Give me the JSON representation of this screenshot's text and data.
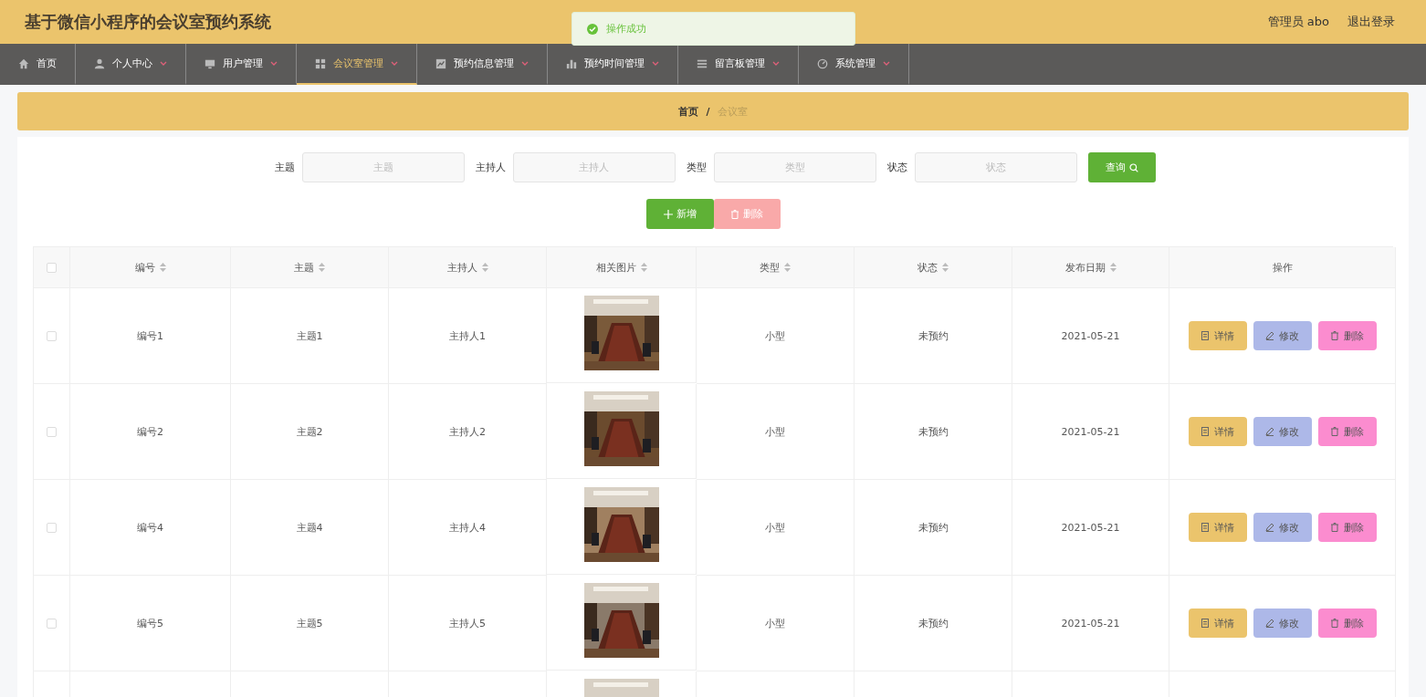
{
  "header": {
    "title": "基于微信小程序的会议室预约系统",
    "user": "管理员 abo",
    "logout": "退出登录"
  },
  "toast": {
    "message": "操作成功"
  },
  "nav": [
    {
      "label": "首页",
      "dropdown": false,
      "selected": false
    },
    {
      "label": "个人中心",
      "dropdown": true,
      "selected": false
    },
    {
      "label": "用户管理",
      "dropdown": true,
      "selected": false
    },
    {
      "label": "会议室管理",
      "dropdown": true,
      "selected": true
    },
    {
      "label": "预约信息管理",
      "dropdown": true,
      "selected": false
    },
    {
      "label": "预约时间管理",
      "dropdown": true,
      "selected": false
    },
    {
      "label": "留言板管理",
      "dropdown": true,
      "selected": false
    },
    {
      "label": "系统管理",
      "dropdown": true,
      "selected": false
    }
  ],
  "breadcrumb": {
    "items": [
      "首页",
      "会议室"
    ],
    "separator": "/"
  },
  "search": [
    {
      "label": "主题",
      "placeholder": "主题"
    },
    {
      "label": "主持人",
      "placeholder": "主持人"
    },
    {
      "label": "类型",
      "placeholder": "类型"
    },
    {
      "label": "状态",
      "placeholder": "状态"
    }
  ],
  "search_button": "查询",
  "add_button": "新增",
  "delete_button": {
    "label": "删除",
    "disabled": true
  },
  "table": {
    "select_all_checked": false,
    "columns": [
      "编号",
      "主题",
      "主持人",
      "相关图片",
      "类型",
      "状态",
      "发布日期",
      "操作"
    ],
    "rows": [
      {
        "checked": false,
        "cells": [
          "编号1",
          "主题1",
          "主持人1"
        ],
        "image": {
          "kind": "picture"
        },
        "tail": [
          "小型",
          "未预约",
          "2021-05-21"
        ],
        "actions": [
          "详情",
          "修改",
          "删除"
        ]
      },
      {
        "checked": false,
        "cells": [
          "编号2",
          "主题2",
          "主持人2"
        ],
        "image": {
          "kind": "picture"
        },
        "tail": [
          "小型",
          "未预约",
          "2021-05-21"
        ],
        "actions": [
          "详情",
          "修改",
          "删除"
        ]
      },
      {
        "checked": false,
        "cells": [
          "编号4",
          "主题4",
          "主持人4"
        ],
        "image": {
          "kind": "picture"
        },
        "tail": [
          "小型",
          "未预约",
          "2021-05-21"
        ],
        "actions": [
          "详情",
          "修改",
          "删除"
        ]
      },
      {
        "checked": false,
        "cells": [
          "编号5",
          "主题5",
          "主持人5"
        ],
        "image": {
          "kind": "picture"
        },
        "tail": [
          "小型",
          "未预约",
          "2021-05-21"
        ],
        "actions": [
          "详情",
          "修改",
          "删除"
        ]
      },
      {
        "image": {
          "kind": "picture"
        }
      }
    ]
  }
}
